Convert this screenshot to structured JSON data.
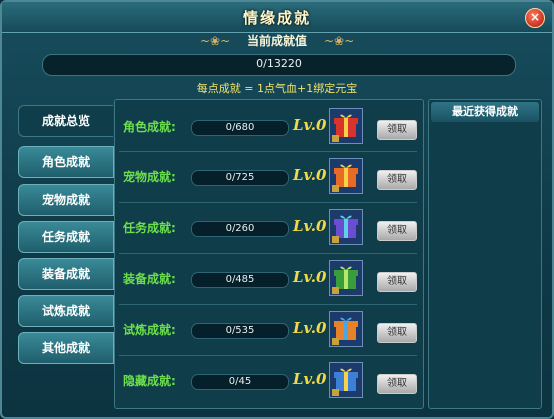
{
  "window": {
    "title": "情缘成就"
  },
  "current": {
    "title": "当前成就值",
    "progress": "0/13220",
    "fraction": 0
  },
  "note": "每点成就 = 1点气血+1绑定元宝",
  "tabs": [
    {
      "label": "成就总览",
      "active": true
    },
    {
      "label": "角色成就"
    },
    {
      "label": "宠物成就"
    },
    {
      "label": "任务成就"
    },
    {
      "label": "装备成就"
    },
    {
      "label": "试炼成就"
    },
    {
      "label": "其他成就"
    }
  ],
  "rows": [
    {
      "label": "角色成就:",
      "progress": "0/680",
      "level": "0",
      "gift_color": "#d9342b",
      "button": "领取"
    },
    {
      "label": "宠物成就:",
      "progress": "0/725",
      "level": "0",
      "gift_color": "#e76a25",
      "button": "领取"
    },
    {
      "label": "任务成就:",
      "progress": "0/260",
      "level": "0",
      "gift_color": "#6a4dd1",
      "button": "领取"
    },
    {
      "label": "装备成就:",
      "progress": "0/485",
      "level": "0",
      "gift_color": "#3a9d3c",
      "button": "领取"
    },
    {
      "label": "试炼成就:",
      "progress": "0/535",
      "level": "0",
      "gift_color": "#e5822a",
      "button": "领取"
    },
    {
      "label": "隐藏成就:",
      "progress": "0/45",
      "level": "0",
      "gift_color": "#3b7fd6",
      "button": "领取"
    }
  ],
  "right_panel": {
    "title": "最近获得成就"
  },
  "level_prefix": "Lv."
}
